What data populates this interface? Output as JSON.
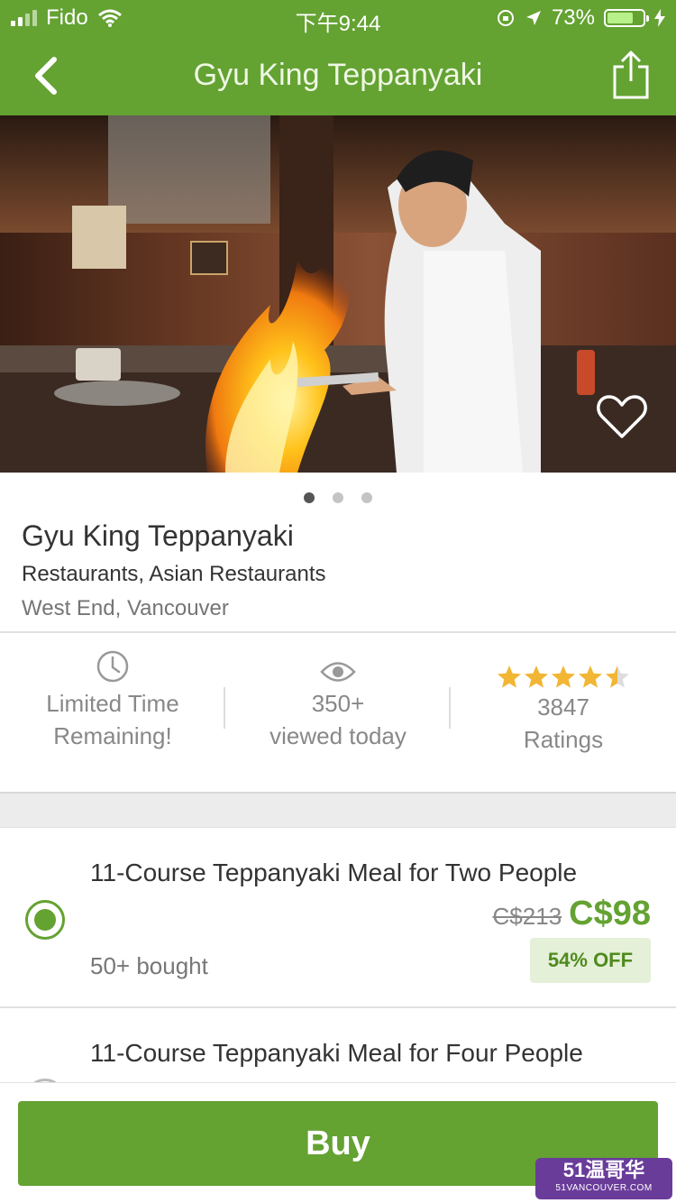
{
  "status_bar": {
    "carrier": "Fido",
    "time": "下午9:44",
    "battery": "73%",
    "battery_level": 0.73
  },
  "nav": {
    "title": "Gyu King Teppanyaki",
    "back_icon": "chevron-left-icon",
    "share_icon": "share-icon"
  },
  "hero": {
    "favorite_icon": "heart-outline-icon",
    "page_count": 3,
    "active_page": 1
  },
  "deal": {
    "title": "Gyu King Teppanyaki",
    "categories": "Restaurants, Asian Restaurants",
    "location": "West End, Vancouver"
  },
  "stats": {
    "limited_line1": "Limited Time",
    "limited_line2": "Remaining!",
    "views_count": "350+",
    "views_label": "viewed today",
    "rating_count": "3847",
    "rating_label": "Ratings",
    "rating_value": 4.5,
    "rating_max": 5
  },
  "options": [
    {
      "title": "11-Course Teppanyaki Meal for Two People",
      "original_price": "C$213",
      "price": "C$98",
      "bought": "50+ bought",
      "discount": "54% OFF",
      "selected": true
    },
    {
      "title": "11-Course Teppanyaki Meal for Four People",
      "selected": false
    }
  ],
  "buy_label": "Buy",
  "watermark": {
    "line1": "51温哥华",
    "line2": "51VANCOUVER.COM"
  },
  "colors": {
    "brand_green": "#64a232",
    "star_gold": "#f1b634",
    "badge_bg": "#e4f0d8"
  }
}
